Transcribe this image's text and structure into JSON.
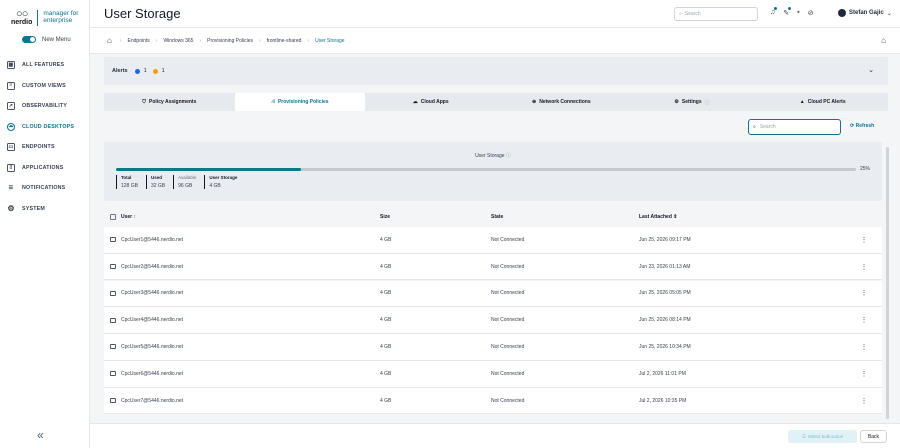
{
  "logo": {
    "word": "nerdio",
    "tag": "manager for enterprise"
  },
  "sidebar": {
    "new_menu": "New Menu",
    "items": [
      {
        "label": "ALL FEATURES",
        "icon": "grid-icon"
      },
      {
        "label": "CUSTOM VIEWS",
        "icon": "views-icon"
      },
      {
        "label": "OBSERVABILITY",
        "icon": "chart-icon"
      },
      {
        "label": "CLOUD DESKTOPS",
        "icon": "cloud-icon"
      },
      {
        "label": "ENDPOINTS",
        "icon": "endpoints-icon"
      },
      {
        "label": "APPLICATIONS",
        "icon": "apps-icon"
      },
      {
        "label": "NOTIFICATIONS",
        "icon": "list-icon"
      },
      {
        "label": "SYSTEM",
        "icon": "gear-icon"
      }
    ],
    "collapse": "«"
  },
  "header": {
    "title": "User Storage",
    "search_placeholder": "Search",
    "user_name": "Stefan Gajic"
  },
  "breadcrumb": [
    "Endpoints",
    "Windows 365",
    "Provisioning Policies",
    "frontline-shared",
    "User Storage"
  ],
  "alerts": {
    "label": "Alerts",
    "info_count": "1",
    "warn_count": "1",
    "info_color": "#2563eb",
    "warn_color": "#f59e0b"
  },
  "tabs": [
    {
      "label": "Policy Assignments",
      "icon": "policy-icon"
    },
    {
      "label": "Provisioning Policies",
      "icon": "hierarchy-icon"
    },
    {
      "label": "Cloud Apps",
      "icon": "cloud-icon"
    },
    {
      "label": "Network Connections",
      "icon": "network-icon"
    },
    {
      "label": "Settings",
      "icon": "gear-icon"
    },
    {
      "label": "Cloud PC Alerts",
      "icon": "warning-icon"
    }
  ],
  "active_tab": 1,
  "toolbar": {
    "search_placeholder": "Search",
    "refresh_label": "Refresh"
  },
  "storage": {
    "title": "User Storage",
    "used_fraction": 0.25,
    "percent_label": "25%",
    "stats": [
      {
        "label": "Total",
        "value": "128 GB"
      },
      {
        "label": "Used",
        "value": "32 GB"
      },
      {
        "label": "Available",
        "value": "96 GB"
      },
      {
        "label": "User Storage",
        "value": "4 GB"
      }
    ]
  },
  "table": {
    "columns": [
      "User ↑",
      "Size",
      "State",
      "Last Attached ⇕"
    ],
    "rows": [
      {
        "user": "CpcUser1@5446.nerdio.net",
        "size": "4 GB",
        "state": "Not Connected",
        "last": "Jun 25, 2026 09:17 PM"
      },
      {
        "user": "CpcUser2@5446.nerdio.net",
        "size": "4 GB",
        "state": "Not Connected",
        "last": "Jun 23, 2026 01:13 AM"
      },
      {
        "user": "CpcUser3@5446.nerdio.net",
        "size": "4 GB",
        "state": "Not Connected",
        "last": "Jun 25, 2026 05:05 PM"
      },
      {
        "user": "CpcUser4@5446.nerdio.net",
        "size": "4 GB",
        "state": "Not Connected",
        "last": "Jun 25, 2026 08:14 PM"
      },
      {
        "user": "CpcUser5@5446.nerdio.net",
        "size": "4 GB",
        "state": "Not Connected",
        "last": "Jun 25, 2026 10:34 PM"
      },
      {
        "user": "CpcUser6@5446.nerdio.net",
        "size": "4 GB",
        "state": "Not Connected",
        "last": "Jul 2, 2026 11:01 PM"
      },
      {
        "user": "CpcUser7@5446.nerdio.net",
        "size": "4 GB",
        "state": "Not Connected",
        "last": "Jul 2, 2026 10:35 PM"
      }
    ]
  },
  "footer": {
    "bulk_label": "Select bulk action",
    "back_label": "Back"
  },
  "accent_color": "#0e7490"
}
